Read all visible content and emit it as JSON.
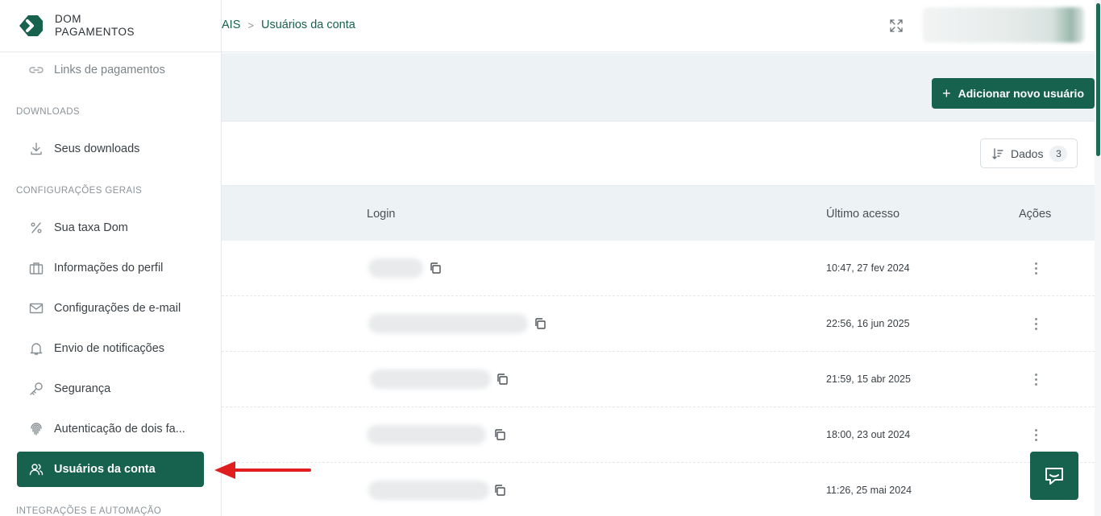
{
  "brand": {
    "line1": "DOM",
    "line2": "PAGAMENTOS",
    "icon": "dom-logo"
  },
  "sidebar": {
    "top_item": {
      "label": "Links de pagamentos",
      "icon": "link-icon"
    },
    "sections": [
      {
        "label": "DOWNLOADS"
      },
      {
        "label": "CONFIGURAÇÕES GERAIS"
      },
      {
        "label": "INTEGRAÇÕES E AUTOMAÇÃO"
      }
    ],
    "items": [
      {
        "label": "Seus downloads",
        "icon": "download-icon"
      },
      {
        "label": "Sua taxa Dom",
        "icon": "percent-icon"
      },
      {
        "label": "Informações do perfil",
        "icon": "briefcase-icon"
      },
      {
        "label": "Configurações de e-mail",
        "icon": "mail-icon"
      },
      {
        "label": "Envio de notificações",
        "icon": "bell-icon"
      },
      {
        "label": "Segurança",
        "icon": "key-icon"
      },
      {
        "label": "Autenticação de dois fa...",
        "icon": "fingerprint-icon"
      },
      {
        "label": "Usuários da conta",
        "icon": "users-icon",
        "active": true
      }
    ]
  },
  "header": {
    "breadcrumb_prev": "AIS",
    "breadcrumb_sep": ">",
    "breadcrumb_current": "Usuários da conta"
  },
  "toolbar": {
    "add_user_label": "Adicionar novo usuário",
    "add_user_icon": "+"
  },
  "filter": {
    "dados_label": "Dados",
    "dados_count": "3"
  },
  "table": {
    "columns": [
      "Login",
      "Último acesso",
      "Ações"
    ],
    "rows": [
      {
        "last_access": "10:47, 27 fev 2024"
      },
      {
        "last_access": "22:56, 16 jun 2025"
      },
      {
        "last_access": "21:59, 15 abr 2025"
      },
      {
        "last_access": "18:00, 23 out 2024"
      },
      {
        "last_access": "11:26, 25 mai 2024"
      }
    ]
  },
  "colors": {
    "accent": "#17614f",
    "band": "#edf2f4",
    "annotation": "#e01e1e"
  }
}
